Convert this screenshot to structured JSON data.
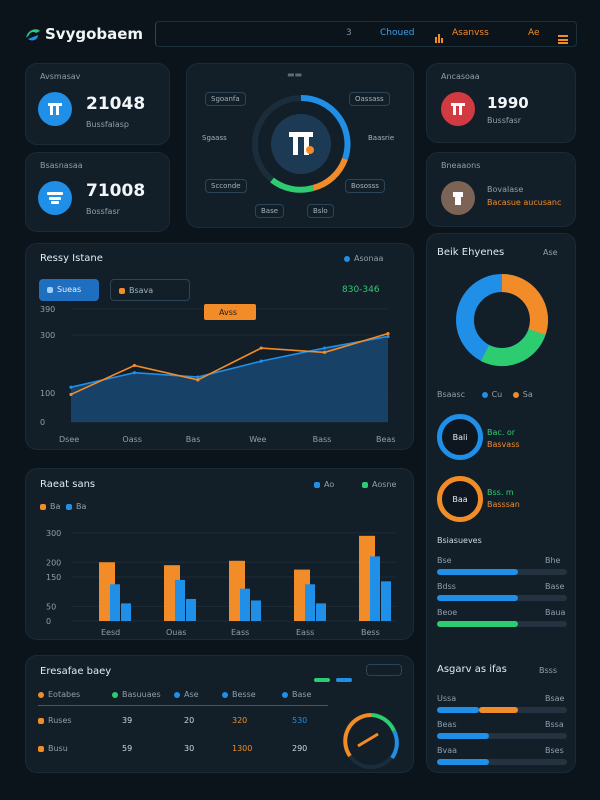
{
  "brand": {
    "name": "Svygobaem"
  },
  "topnav": {
    "search": "Choued",
    "item2": "Asanvss",
    "item3": "Ae"
  },
  "stats": [
    {
      "label": "Avsmasav",
      "value": "21048",
      "sub": "Bussfalasp"
    },
    {
      "label": "Bsasnasaa",
      "value": "71008",
      "sub": "Bossfasr"
    },
    {
      "label": "Ancasoaa",
      "value": "1990",
      "sub": "Bussfasr"
    },
    {
      "label": "Bneaaons",
      "sub1": "Bovalase",
      "sub2": "Bacasue aucusanc"
    }
  ],
  "ring_card": {
    "tags": [
      "Sgoanfa",
      "Oassass",
      "Sgaass",
      "Baasrie",
      "Scconde",
      "Bososss"
    ],
    "btn1": "Base",
    "btn2": "Bslo"
  },
  "line_chart": {
    "title": "Ressy Istane",
    "legend": "Asonaa",
    "tab_active": "Sueas",
    "tab2": "Bsava",
    "highlight_label": "Avss",
    "value_readout": "830-346",
    "colors": {
      "line1": "#f28c28",
      "line2": "#1f8fe8"
    }
  },
  "bar_chart": {
    "title": "Raeat sans",
    "legend": [
      "Ao",
      "Aosne"
    ],
    "legend_small": [
      "Ba",
      "Ba"
    ]
  },
  "donut_panel": {
    "title": "Beik Ehyenes",
    "pct": "Ase",
    "legend": [
      "Bsaasc",
      "Cu",
      "Sa"
    ],
    "ring1": {
      "center": "Bali",
      "line1": "Bac. or",
      "line2": "Basvass"
    },
    "ring2": {
      "center": "Baa",
      "line1": "Bss. m",
      "line2": "Basssan"
    }
  },
  "progress1": {
    "title": "Bsiasueves",
    "rows": [
      {
        "label": "Bse",
        "value": "Bhe"
      },
      {
        "label": "Bdss",
        "value": "Base"
      },
      {
        "label": "Beoe",
        "value": "Baua"
      }
    ]
  },
  "progress2": {
    "title": "Asgarv as ifas",
    "tag": "Bsss",
    "rows": [
      {
        "label": "Ussa",
        "value": "Bsae"
      },
      {
        "label": "Beas",
        "value": "Bssa"
      },
      {
        "label": "Bvaa",
        "value": "Bses"
      }
    ]
  },
  "table": {
    "title": "Eresafae baey",
    "headers": [
      "Eotabes",
      "Basuuaes",
      "Ase",
      "Besse",
      "Base"
    ],
    "rows": [
      [
        "Ruses",
        "39",
        "20",
        "320",
        "530"
      ],
      [
        "Busu",
        "59",
        "30",
        "1300",
        "290"
      ]
    ]
  },
  "chart_data": [
    {
      "type": "line",
      "title": "Ressy Istane",
      "y_ticks": [
        "390",
        "300",
        "100",
        "0"
      ],
      "categories": [
        "Dsee",
        "Oass",
        "Bas",
        "Wee",
        "Bass",
        "Beas"
      ],
      "series": [
        {
          "name": "",
          "values": [
            95,
            195,
            145,
            255,
            240,
            305
          ]
        },
        {
          "name": "",
          "values": [
            120,
            170,
            155,
            210,
            255,
            295
          ]
        }
      ],
      "ylim": [
        0,
        400
      ]
    },
    {
      "type": "bar",
      "title": "Raeat sans",
      "y_ticks": [
        "300",
        "200",
        "150",
        "50",
        "0"
      ],
      "categories": [
        "Eesd",
        "Ouas",
        "Eass",
        "Eass",
        "Bess"
      ],
      "series": [
        {
          "name": "Ao",
          "values": [
            200,
            190,
            205,
            175,
            290
          ]
        },
        {
          "name": "Aosne",
          "values": [
            125,
            140,
            110,
            125,
            220
          ]
        },
        {
          "name": "",
          "values": [
            60,
            75,
            70,
            60,
            135
          ]
        }
      ],
      "ylim": [
        0,
        320
      ]
    }
  ]
}
